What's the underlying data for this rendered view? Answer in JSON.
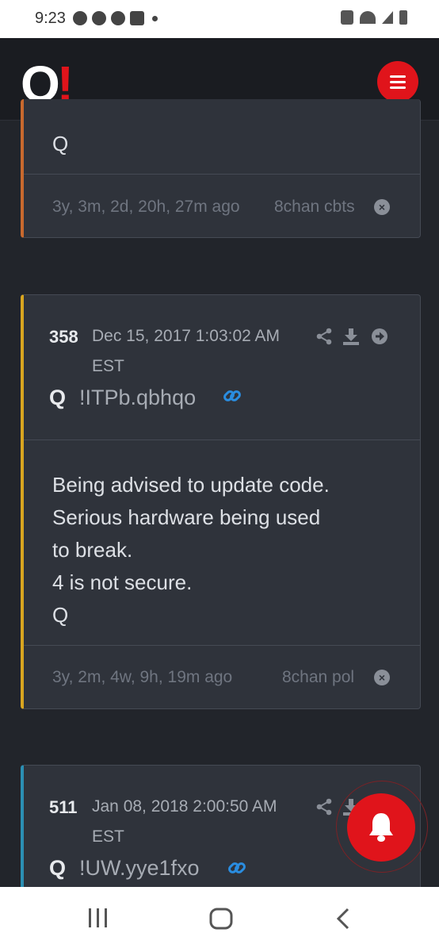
{
  "status_bar": {
    "time": "9:23"
  },
  "header": {
    "logo_q": "Q",
    "logo_bang": "!"
  },
  "posts": [
    {
      "body_lines": [
        "Q"
      ],
      "ago": "3y, 3m, 2d, 20h, 27m ago",
      "board": "8chan cbts",
      "accent": "#c8692e"
    },
    {
      "number": "358",
      "date": "Dec 15, 2017 1:03:02 AM EST",
      "author": "Q",
      "tripcode": "!ITPb.qbhqo",
      "body_lines": [
        "Being advised to update code.",
        "Serious hardware being used",
        "to break.",
        "4 is not secure.",
        "Q"
      ],
      "ago": "3y, 2m, 4w, 9h, 19m ago",
      "board": "8chan pol",
      "accent": "#d9a520"
    },
    {
      "number": "511",
      "date": "Jan 08, 2018 2:00:50 AM EST",
      "author": "Q",
      "tripcode": "!UW.yye1fxo",
      "accent": "#2b8fb3"
    }
  ],
  "colors": {
    "brand_red": "#e0141b",
    "link_blue": "#2a8de0",
    "background": "#22252b"
  },
  "icons": [
    "share-icon",
    "download-icon",
    "arrow-circle-right-icon",
    "link-icon",
    "close-circle-icon",
    "bell-icon",
    "menu-icon"
  ]
}
